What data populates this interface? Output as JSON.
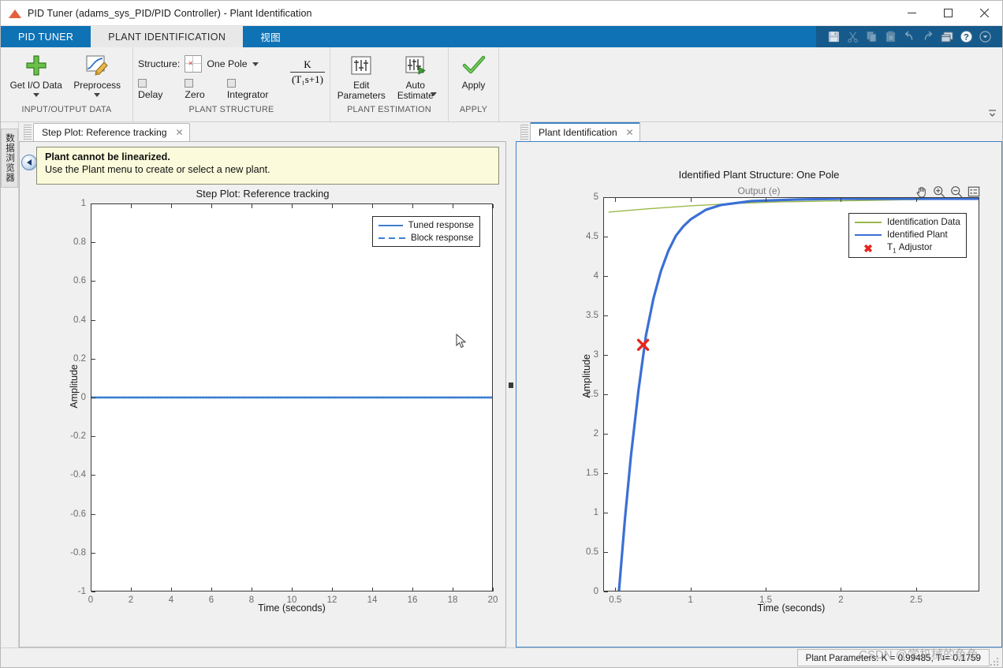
{
  "window": {
    "title": "PID Tuner (adams_sys_PID/PID Controller) - Plant Identification",
    "app_icon": "matlab-icon",
    "minimize": "─",
    "maximize": "□",
    "close": "✕"
  },
  "ribbon": {
    "tabs": [
      {
        "label": "PID TUNER",
        "active": false
      },
      {
        "label": "PLANT IDENTIFICATION",
        "active": true
      },
      {
        "label": "视图",
        "active": false
      }
    ],
    "quick_access": [
      "save-icon",
      "cut-icon",
      "copy-icon",
      "paste-icon",
      "undo-icon",
      "redo-icon",
      "layout-icon",
      "help-icon",
      "more-icon"
    ],
    "groups": [
      {
        "title": "INPUT/OUTPUT DATA",
        "buttons": [
          {
            "label": "Get I/O Data",
            "icon": "green-plus-icon",
            "has_menu": true
          },
          {
            "label": "Preprocess",
            "icon": "preprocess-icon",
            "has_menu": true
          }
        ]
      },
      {
        "title": "PLANT STRUCTURE",
        "structure_label": "Structure:",
        "structure_value": "One Pole",
        "checkboxes": [
          {
            "label": "Delay",
            "checked": false
          },
          {
            "label": "Zero",
            "checked": false
          },
          {
            "label": "Integrator",
            "checked": false
          }
        ],
        "transfer_function": {
          "numerator": "K",
          "denominator": "(T₁s+1)"
        }
      },
      {
        "title": "PLANT ESTIMATION",
        "buttons": [
          {
            "label": "Edit\nParameters",
            "icon": "edit-parameters-icon",
            "has_menu": false
          },
          {
            "label": "Auto\nEstimate",
            "icon": "auto-estimate-icon",
            "has_menu": true
          }
        ]
      },
      {
        "title": "APPLY",
        "buttons": [
          {
            "label": "Apply",
            "icon": "green-check-icon",
            "has_menu": false
          }
        ]
      }
    ]
  },
  "data_browser": {
    "label": "数据浏览器"
  },
  "left_panel": {
    "tab": {
      "label": "Step Plot: Reference tracking",
      "close": "✕"
    },
    "warning": {
      "bold": "Plant cannot be linearized.",
      "normal": "Use the Plant menu to create or select a new plant."
    }
  },
  "right_panel": {
    "tab": {
      "label": "Plant Identification",
      "close": "✕"
    },
    "tools": [
      "pan-icon",
      "zoom-in-icon",
      "zoom-out-icon",
      "data-tips-icon"
    ]
  },
  "statusbar": {
    "text": "Plant Parameters: K = 0.99485, T",
    "sub": "1",
    "text2": " = 0.1759",
    "watermark": "CSDN @学机械的鱼鱼"
  },
  "colors": {
    "accent_blue": "#0e72b5",
    "tuned_blue": "#3f7fd0",
    "identified_plant": "#3b6fd4",
    "identification_data": "#9cb84b",
    "marker_red": "#e8241b",
    "warning_bg": "#fbfbdc"
  },
  "chart_data": [
    {
      "type": "line",
      "id": "step-plot-reference-tracking",
      "title": "Step Plot: Reference tracking",
      "xlabel": "Time (seconds)",
      "ylabel": "Amplitude",
      "xlim": [
        0,
        20
      ],
      "ylim": [
        -1,
        1
      ],
      "xticks": [
        0,
        2,
        4,
        6,
        8,
        10,
        12,
        14,
        16,
        18,
        20
      ],
      "yticks": [
        -1,
        -0.8,
        -0.6,
        -0.4,
        -0.2,
        0,
        0.2,
        0.4,
        0.6,
        0.8,
        1
      ],
      "grid": false,
      "legend_position": "upper right",
      "series": [
        {
          "name": "Tuned response",
          "color": "#3f7fd0",
          "style": "solid",
          "x": [
            0,
            20
          ],
          "values": [
            0,
            0
          ]
        },
        {
          "name": "Block response",
          "color": "#3f7fd0",
          "style": "dashed",
          "x": [
            0,
            20
          ],
          "values": [
            0,
            0
          ]
        }
      ]
    },
    {
      "type": "line",
      "id": "plant-identification-plot",
      "title": "Identified Plant Structure: One Pole",
      "subtitle": "Output (e)",
      "xlabel": "Time (seconds)",
      "ylabel": "Amplitude",
      "xlim": [
        0.42,
        2.92
      ],
      "ylim": [
        0,
        5
      ],
      "xticks": [
        0.5,
        1,
        1.5,
        2,
        2.5
      ],
      "yticks": [
        0,
        0.5,
        1,
        1.5,
        2,
        2.5,
        3,
        3.5,
        4,
        4.5,
        5
      ],
      "grid": false,
      "legend_position": "upper right",
      "series": [
        {
          "name": "Identification Data",
          "color": "#9cb84b",
          "style": "solid",
          "x": [
            0.45,
            0.7,
            1.0,
            1.3,
            1.6,
            1.9,
            2.2,
            2.5,
            2.92
          ],
          "values": [
            4.82,
            4.86,
            4.9,
            4.93,
            4.95,
            4.96,
            4.97,
            4.98,
            4.99
          ]
        },
        {
          "name": "Identified Plant",
          "color": "#3b6fd4",
          "style": "solid",
          "x": [
            0.52,
            0.56,
            0.6,
            0.65,
            0.7,
            0.75,
            0.8,
            0.85,
            0.9,
            0.95,
            1.0,
            1.1,
            1.2,
            1.4,
            1.7,
            2.0,
            2.5,
            2.92
          ],
          "values": [
            0.0,
            0.92,
            1.72,
            2.55,
            3.25,
            3.72,
            4.07,
            4.33,
            4.52,
            4.64,
            4.73,
            4.85,
            4.91,
            4.96,
            4.98,
            4.99,
            4.99,
            4.99
          ]
        },
        {
          "name": "T₁ Adjustor",
          "color": "#e8241b",
          "style": "marker",
          "marker": "x",
          "x": [
            0.681
          ],
          "values": [
            3.13
          ]
        }
      ]
    }
  ]
}
